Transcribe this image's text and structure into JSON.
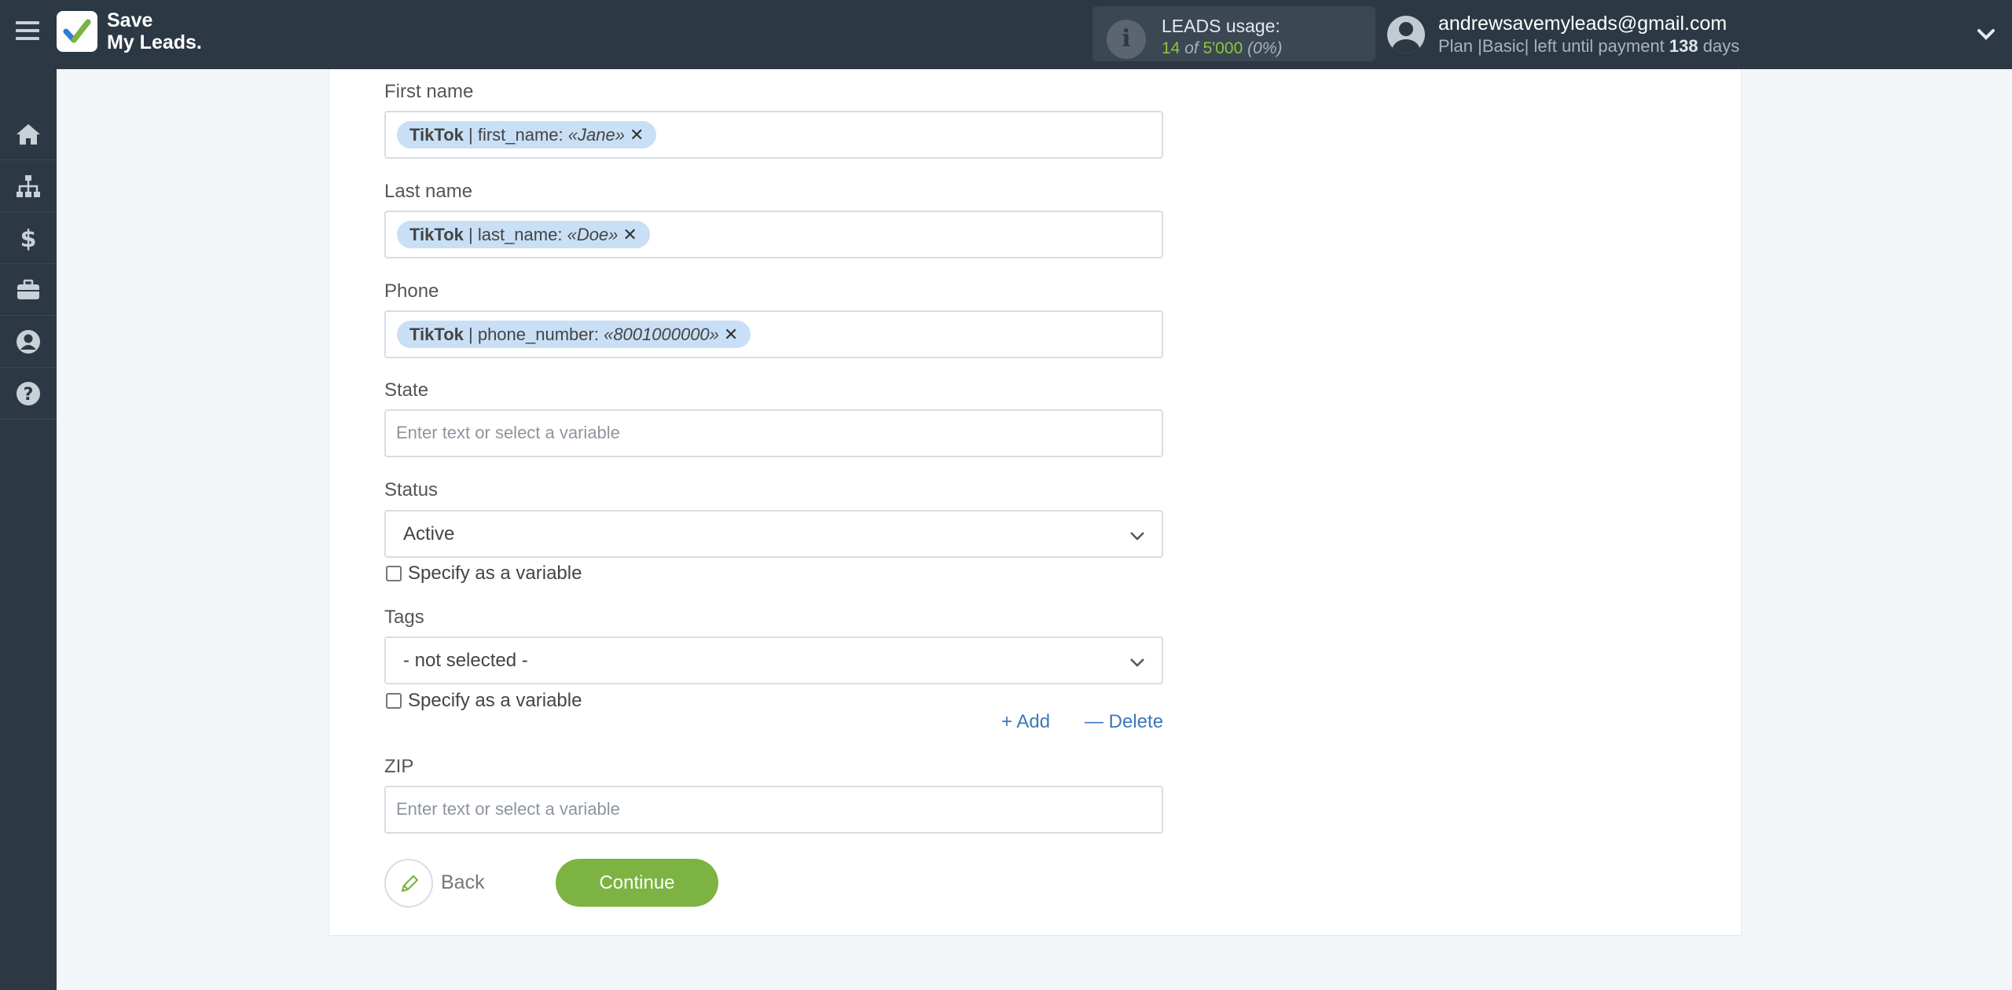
{
  "header": {
    "logo_line1": "Save",
    "logo_line2": "My Leads.",
    "usage_label": "LEADS usage:",
    "usage_used": "14",
    "usage_of": "of",
    "usage_total": "5'000",
    "usage_percent": "(0%)",
    "email": "andrewsavemyleads@gmail.com",
    "plan_prefix": "Plan |Basic| left until payment",
    "plan_days": "138",
    "plan_suffix": "days"
  },
  "sidebar": {
    "items": [
      "home-icon",
      "sitemap-icon",
      "dollar-icon",
      "briefcase-icon",
      "user-circle-icon",
      "question-circle-icon"
    ]
  },
  "form": {
    "first_name": {
      "label": "First name",
      "chip_source": "TikTok",
      "chip_sep": "| first_name:",
      "chip_value": "«Jane»"
    },
    "last_name": {
      "label": "Last name",
      "chip_source": "TikTok",
      "chip_sep": "| last_name:",
      "chip_value": "«Doe»"
    },
    "phone": {
      "label": "Phone",
      "chip_source": "TikTok",
      "chip_sep": "| phone_number:",
      "chip_value": "«8001000000»"
    },
    "state": {
      "label": "State",
      "placeholder": "Enter text or select a variable"
    },
    "status": {
      "label": "Status",
      "value": "Active",
      "specify_label": "Specify as a variable"
    },
    "tags": {
      "label": "Tags",
      "value": "- not selected -",
      "specify_label": "Specify as a variable"
    },
    "add_label": "Add",
    "delete_label": "Delete",
    "zip": {
      "label": "ZIP",
      "placeholder": "Enter text or select a variable"
    },
    "back_label": "Back",
    "continue_label": "Continue"
  },
  "colors": {
    "header_bg": "#2c3844",
    "accent_green": "#7cb342",
    "chip_bg": "#c9dff5",
    "link_blue": "#3b79b8"
  }
}
